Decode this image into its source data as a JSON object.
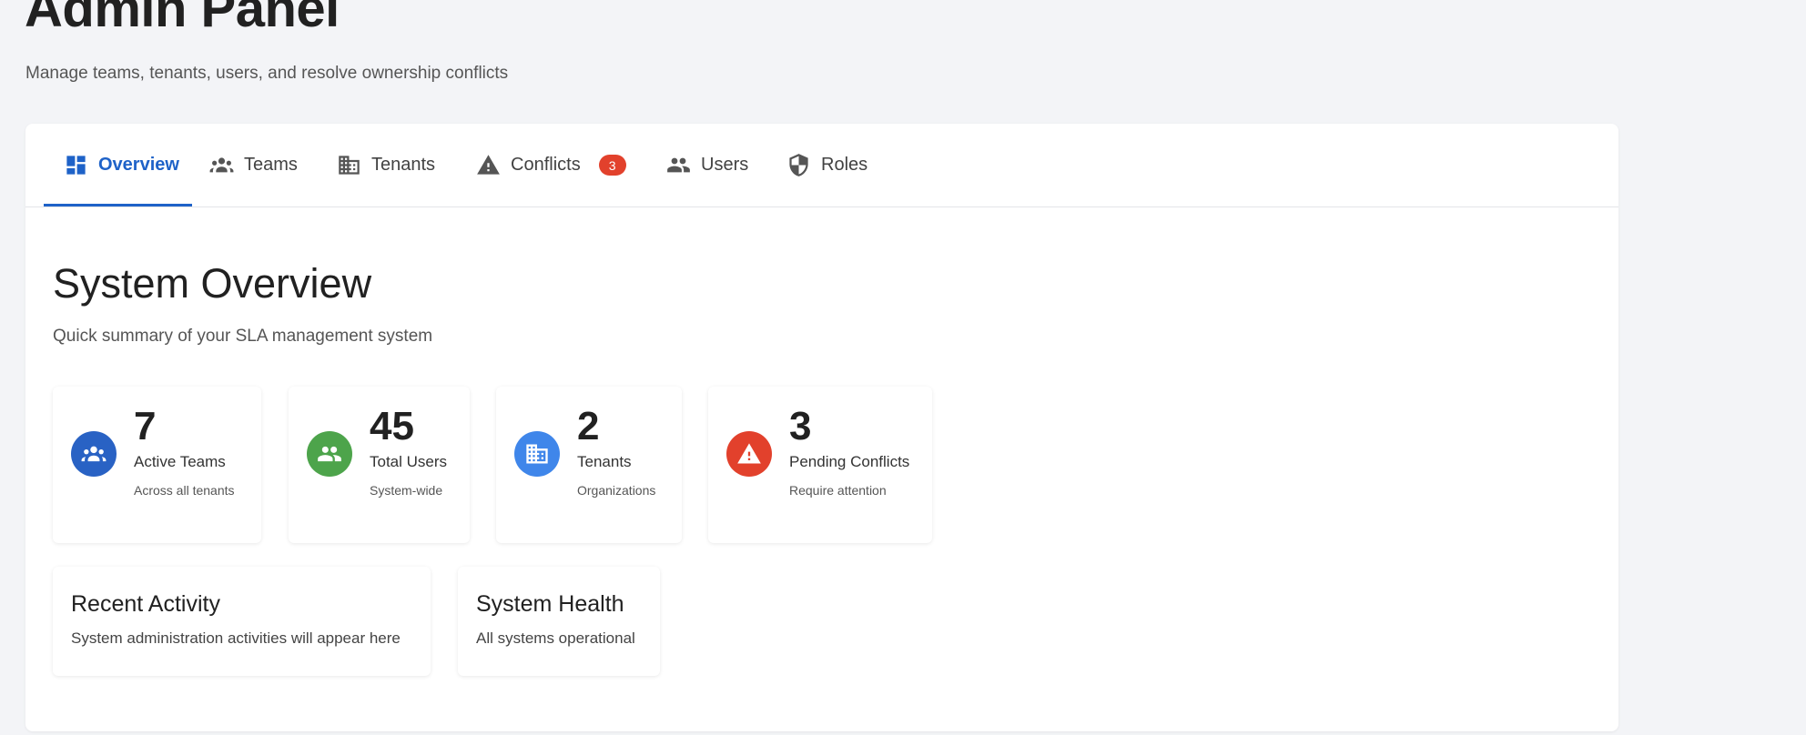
{
  "header": {
    "title": "Admin Panel",
    "subtitle": "Manage teams, tenants, users, and resolve ownership conflicts"
  },
  "tabs": [
    {
      "label": "Overview",
      "icon": "dashboard-icon",
      "active": true
    },
    {
      "label": "Teams",
      "icon": "groups-icon",
      "active": false
    },
    {
      "label": "Tenants",
      "icon": "building-icon",
      "active": false
    },
    {
      "label": "Conflicts",
      "icon": "warning-icon",
      "active": false,
      "badge": "3"
    },
    {
      "label": "Users",
      "icon": "people-icon",
      "active": false
    },
    {
      "label": "Roles",
      "icon": "shield-icon",
      "active": false
    }
  ],
  "overview": {
    "title": "System Overview",
    "subtitle": "Quick summary of your SLA management system",
    "stats": [
      {
        "value": "7",
        "label": "Active Teams",
        "caption": "Across all tenants",
        "icon": "groups-icon",
        "color": "#2962c4"
      },
      {
        "value": "45",
        "label": "Total Users",
        "caption": "System-wide",
        "icon": "people-icon",
        "color": "#4da44b"
      },
      {
        "value": "2",
        "label": "Tenants",
        "caption": "Organizations",
        "icon": "building-icon",
        "color": "#3f86ea"
      },
      {
        "value": "3",
        "label": "Pending Conflicts",
        "caption": "Require attention",
        "icon": "warning-icon",
        "color": "#e2412c"
      }
    ],
    "recent_activity": {
      "title": "Recent Activity",
      "text": "System administration activities will appear here"
    },
    "system_health": {
      "title": "System Health",
      "text": "All systems operational"
    }
  },
  "colors": {
    "accent": "#1e62c8",
    "badge": "#e2412c",
    "background": "#f3f4f7"
  }
}
